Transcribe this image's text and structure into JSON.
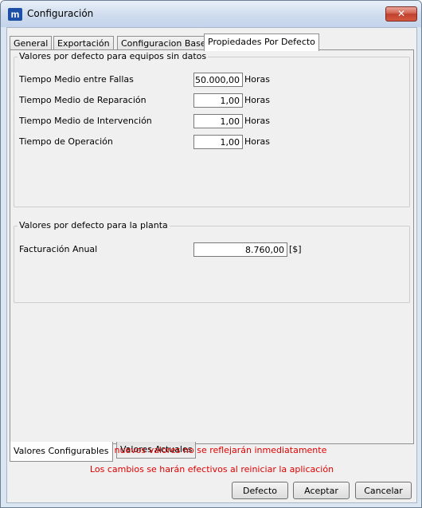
{
  "window": {
    "title": "Configuración",
    "close_glyph": "✕",
    "app_icon_letter": "m"
  },
  "tabs": [
    {
      "label": "General"
    },
    {
      "label": "Exportación"
    },
    {
      "label": "Configuracion Base"
    },
    {
      "label": "Propiedades Por Defecto",
      "active": true
    }
  ],
  "group_equipment": {
    "title": "Valores por defecto para equipos sin datos",
    "rows": [
      {
        "label": "Tiempo Medio entre Fallas",
        "value": "50.000,00",
        "unit": "Horas"
      },
      {
        "label": "Tiempo Medio de Reparación",
        "value": "1,00",
        "unit": "Horas"
      },
      {
        "label": "Tiempo Medio de Intervención",
        "value": "1,00",
        "unit": "Horas"
      },
      {
        "label": "Tiempo de Operación",
        "value": "1,00",
        "unit": "Horas"
      }
    ]
  },
  "group_plant": {
    "title": "Valores por defecto para la planta",
    "rows": [
      {
        "label": "Facturación Anual",
        "value": "8.760,00",
        "unit": "[$]"
      }
    ]
  },
  "bottom_tabs": [
    {
      "label": "Valores Configurables",
      "active": true
    },
    {
      "label": "Valores Actuales"
    }
  ],
  "notices": [
    "Los nuevos valores no se reflejarán inmediatamente",
    "Los cambios se harán efectivos al reiniciar la aplicación"
  ],
  "buttons": {
    "default": "Defecto",
    "accept": "Aceptar",
    "cancel": "Cancelar"
  },
  "colors": {
    "notice": "#e00000",
    "close_button": "#c9503c",
    "app_icon": "#1d4fa6"
  }
}
